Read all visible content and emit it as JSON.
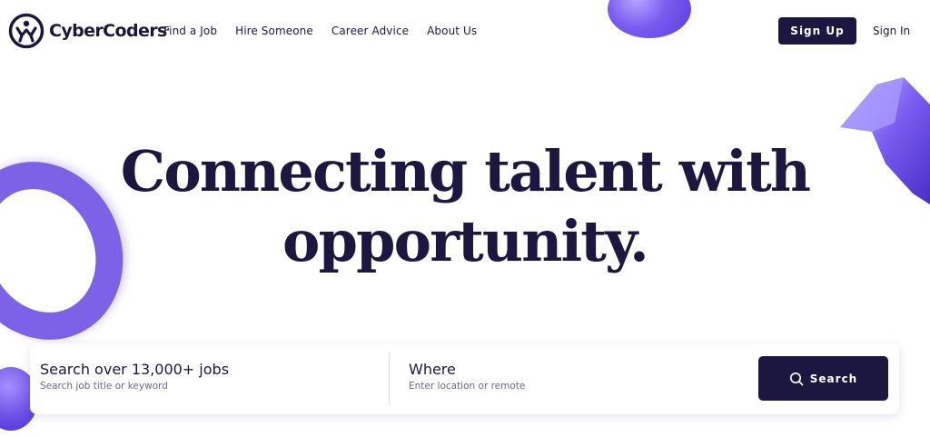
{
  "logo": {
    "text": "CyberCoders",
    "mark": "."
  },
  "nav": {
    "items": [
      {
        "label": "Find a Job"
      },
      {
        "label": "Hire Someone"
      },
      {
        "label": "Career Advice"
      },
      {
        "label": "About Us"
      }
    ]
  },
  "auth": {
    "signup": "Sign Up",
    "signin": "Sign In"
  },
  "hero": {
    "line1": "Connecting talent with",
    "line2": "opportunity."
  },
  "search": {
    "what_label": "Search over 13,000+ jobs",
    "what_placeholder": "Search job title or keyword",
    "where_label": "Where",
    "where_placeholder": "Enter location or remote",
    "button": "Search"
  },
  "colors": {
    "brand_navy": "#1b1740",
    "accent_purple": "#7b5cf0"
  },
  "icons": [
    "cybercoders-logo-icon",
    "search-icon"
  ]
}
